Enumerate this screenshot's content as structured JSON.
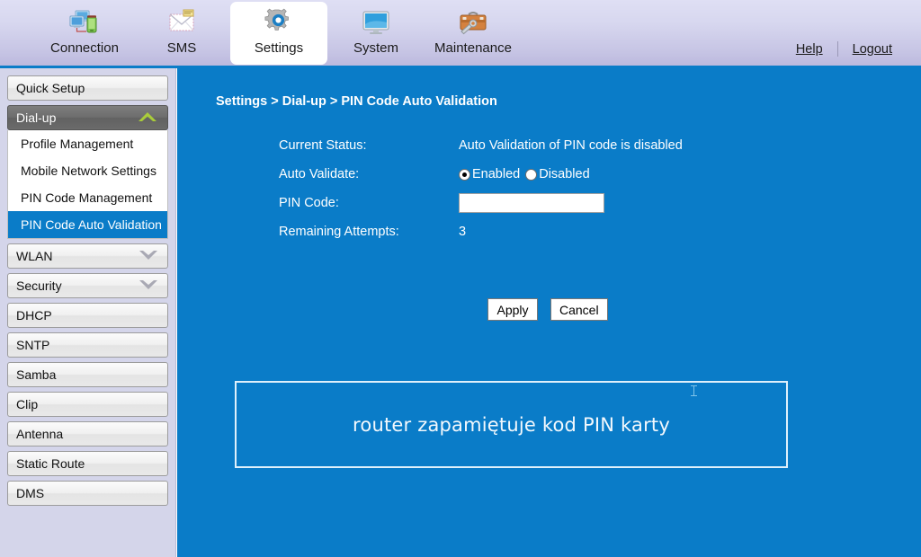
{
  "header": {
    "tabs": [
      {
        "label": "Connection",
        "icon": "network-computers-icon",
        "active": false
      },
      {
        "label": "SMS",
        "icon": "envelope-icon",
        "active": false
      },
      {
        "label": "Settings",
        "icon": "gear-icon",
        "active": true
      },
      {
        "label": "System",
        "icon": "monitor-icon",
        "active": false
      },
      {
        "label": "Maintenance",
        "icon": "toolbox-wrench-icon",
        "active": false
      }
    ],
    "help_label": "Help",
    "logout_label": "Logout"
  },
  "sidebar": {
    "quick_setup": "Quick Setup",
    "dialup": {
      "label": "Dial-up",
      "expanded": true,
      "items": [
        {
          "label": "Profile Management",
          "active": false
        },
        {
          "label": "Mobile Network Settings",
          "active": false
        },
        {
          "label": "PIN Code Management",
          "active": false
        },
        {
          "label": "PIN Code Auto Validation",
          "active": true
        }
      ]
    },
    "items": [
      {
        "label": "WLAN",
        "expandable": true
      },
      {
        "label": "Security",
        "expandable": true
      },
      {
        "label": "DHCP",
        "expandable": false
      },
      {
        "label": "SNTP",
        "expandable": false
      },
      {
        "label": "Samba",
        "expandable": false
      },
      {
        "label": "Clip",
        "expandable": false
      },
      {
        "label": "Antenna",
        "expandable": false
      },
      {
        "label": "Static Route",
        "expandable": false
      },
      {
        "label": "DMS",
        "expandable": false
      }
    ]
  },
  "main": {
    "breadcrumb": "Settings > Dial-up > PIN Code Auto Validation",
    "fields": {
      "current_status_label": "Current Status:",
      "current_status_value": "Auto Validation of PIN code is disabled",
      "auto_validate_label": "Auto Validate:",
      "auto_validate_enabled": "Enabled",
      "auto_validate_disabled": "Disabled",
      "auto_validate_selected": "Enabled",
      "pin_code_label": "PIN Code:",
      "pin_code_value": "",
      "pin_code_placeholder": "",
      "remaining_attempts_label": "Remaining Attempts:",
      "remaining_attempts_value": "3"
    },
    "apply_label": "Apply",
    "cancel_label": "Cancel",
    "annotation": "router zapamiętuje kod PIN karty"
  },
  "colors": {
    "content_blue": "#0a7cc8",
    "sidebar_lavender": "#d4d5ea",
    "active_item_blue": "#0a7cc8",
    "group_head_gray": "#6d6d6d",
    "chevron_green": "#a9cc3a"
  }
}
